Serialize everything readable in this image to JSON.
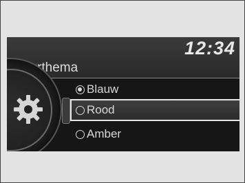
{
  "clock": {
    "time": "12:34"
  },
  "screen": {
    "title": "Kleurthema"
  },
  "options": [
    {
      "label": "Blauw",
      "selected": true,
      "highlighted": false
    },
    {
      "label": "Rood",
      "selected": false,
      "highlighted": true
    },
    {
      "label": "Amber",
      "selected": false,
      "highlighted": false
    }
  ],
  "icons": {
    "settings": "gear-icon"
  },
  "colors": {
    "screen_background": "#161616",
    "header_background": "#333333",
    "text": "#d8d8d8",
    "highlight_border": "#e6e6e6"
  }
}
